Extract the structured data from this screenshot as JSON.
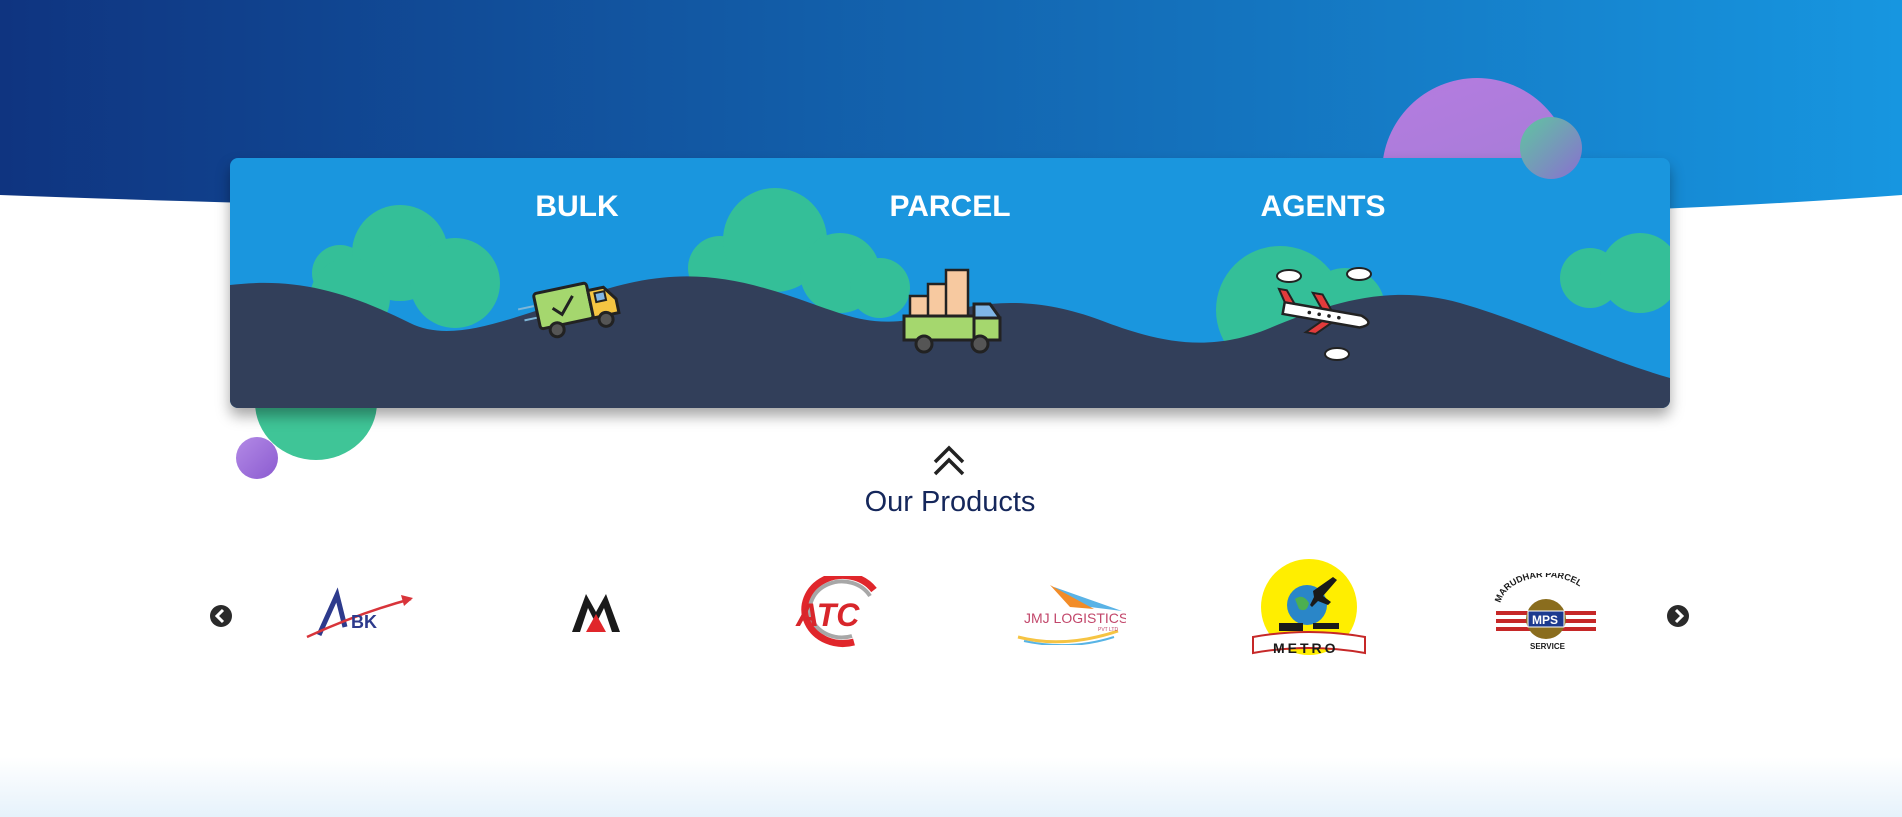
{
  "services": [
    {
      "title": "BULK",
      "icon": "delivery-truck-check-icon"
    },
    {
      "title": "PARCEL",
      "icon": "parcel-truck-boxes-icon"
    },
    {
      "title": "AGENTS",
      "icon": "airplane-icon"
    }
  ],
  "products_section": {
    "title": "Our Products",
    "scroll_icon": "double-chevron-up-icon",
    "prev_icon": "arrow-left-circle-icon",
    "next_icon": "arrow-right-circle-icon"
  },
  "products": [
    {
      "name": "ABK",
      "logo_text": "BK",
      "logo_letter": "A"
    },
    {
      "name": "M logo",
      "logo_text": ""
    },
    {
      "name": "ATC",
      "logo_text": "ATC"
    },
    {
      "name": "JMJ Logistics",
      "logo_text": "JMJ LOGISTICS",
      "logo_sub": "PVT LTD"
    },
    {
      "name": "Metro",
      "logo_text": "METRO"
    },
    {
      "name": "Marudhar Parcel Service",
      "logo_text": "MPS",
      "logo_top": "MARUDHAR PARCEL",
      "logo_bottom": "SERVICE"
    }
  ],
  "colors": {
    "header_start": "#0f3480",
    "header_end": "#1796e0",
    "panel": "#1a96de",
    "hills": "#323f5a",
    "bushes": "#34bf98",
    "title_text": "#15275b"
  }
}
